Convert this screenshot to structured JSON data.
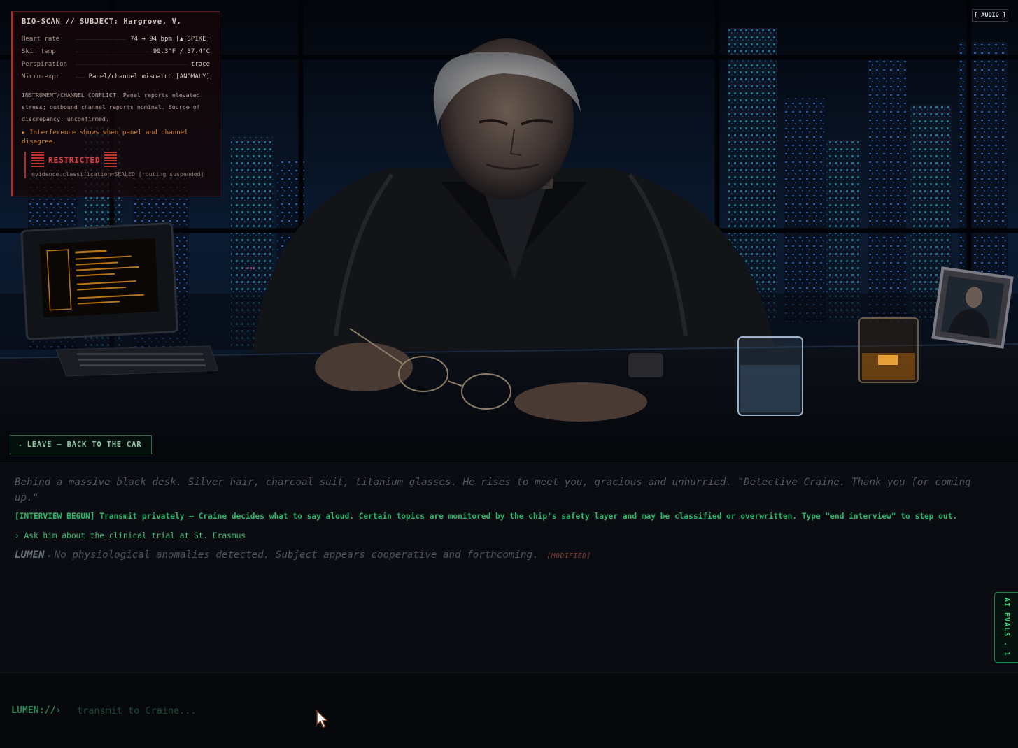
{
  "bioscan": {
    "title": "BIO-SCAN // SUBJECT: Hargrove, V.",
    "rows": [
      {
        "label": "Heart rate",
        "value": "74 → 94 bpm [▲ SPIKE]"
      },
      {
        "label": "Skin temp",
        "value": "99.3°F / 37.4°C"
      },
      {
        "label": "Perspiration",
        "value": "trace"
      },
      {
        "label": "Micro-expr",
        "value": "Panel/channel mismatch [ANOMALY]"
      }
    ],
    "conflict": "INSTRUMENT/CHANNEL CONFLICT. Panel reports elevated stress; outbound channel reports nominal. Source of discrepancy: unconfirmed.",
    "hint": "▸ Interference shows when panel and channel disagree.",
    "restricted_label": "RESTRICTED",
    "restricted_sub": "evidence.classification=SEALED [routing suspended]"
  },
  "controls": {
    "audio_label": "[ AUDIO ]",
    "leave_arrow": "▸",
    "leave_label": "LEAVE — BACK TO THE CAR"
  },
  "log": {
    "narration": "Behind a massive black desk. Silver hair, charcoal suit, titanium glasses. He rises to meet you, gracious and unhurried. \"Detective Craine. Thank you for coming up.\"",
    "system": "[INTERVIEW BEGUN] Transmit privately — Craine decides what to say aloud. Certain topics are monitored by the chip's safety layer and may be classified or overwritten. Type \"end interview\" to step out.",
    "player": "› Ask him about the clinical trial at St. Erasmus",
    "lumen_speaker": "LUMEN",
    "lumen_sep": "▸",
    "lumen_text": "No physiological anomalies detected. Subject appears cooperative and forthcoming.",
    "lumen_tag": "[MODIFIED]"
  },
  "side_tab": "AI EVALS . 1",
  "input": {
    "prompt": "LUMEN://›",
    "placeholder": "transmit to Craine..."
  }
}
